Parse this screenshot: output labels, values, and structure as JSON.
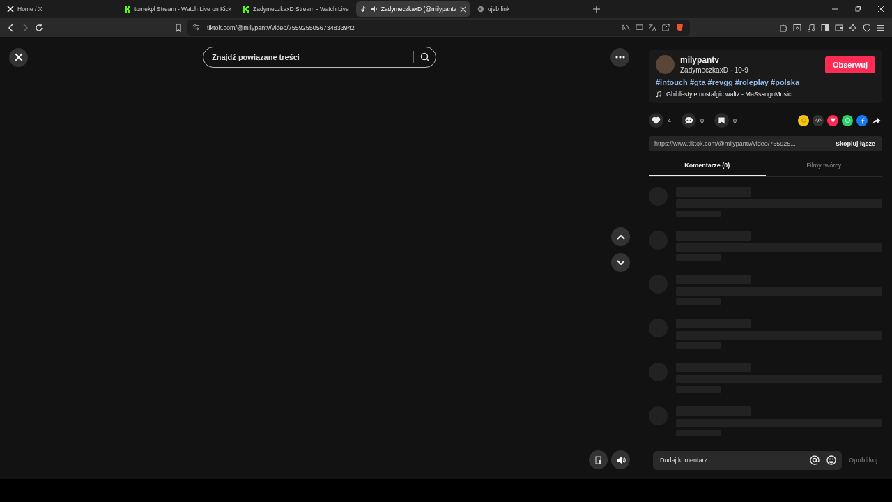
{
  "browser": {
    "tabs": [
      {
        "title": "Home / X",
        "kind": "x",
        "selected": false,
        "audio": false
      },
      {
        "title": "tomekpl Stream - Watch Live on Kick",
        "kind": "kick",
        "selected": false,
        "audio": false
      },
      {
        "title": "ZadymeczkaxD Stream - Watch Live",
        "kind": "kick",
        "selected": false,
        "audio": false
      },
      {
        "title": "ZadymeczkaxD (@milypantv",
        "kind": "tiktok",
        "selected": true,
        "audio": true
      },
      {
        "title": "ujeb link",
        "kind": "globe",
        "selected": false,
        "audio": false
      }
    ],
    "address": "tiktok.com/@milypantv/video/7559255056734833942"
  },
  "search": {
    "placeholder": "Znajdź powiązane treści"
  },
  "post": {
    "username": "milypantv",
    "subtitle": "ZadymeczkaxD · 10-9",
    "follow_label": "Obserwuj",
    "hashtags": "#intouch #gta #revgg #roleplay #polska",
    "music": "Ghibli-style nostalgic waltz - MaSssuguMusic",
    "stats": [
      {
        "kind": "like",
        "count": "4"
      },
      {
        "kind": "comment",
        "count": "0"
      },
      {
        "kind": "save",
        "count": "0"
      }
    ],
    "share_targets": [
      {
        "kind": "coin",
        "color": "#f5c518"
      },
      {
        "kind": "embed",
        "color": "#333333"
      },
      {
        "kind": "send",
        "color": "#fe2c55"
      },
      {
        "kind": "whatsapp",
        "color": "#25d366"
      },
      {
        "kind": "facebook",
        "color": "#1877f2"
      },
      {
        "kind": "forward",
        "color": "#121212"
      }
    ],
    "link": "https://www.tiktok.com/@milypantv/video/755925...",
    "copy_label": "Skopiuj łącze"
  },
  "panel_tabs": [
    {
      "label": "Komentarze (0)",
      "selected": true
    },
    {
      "label": "Filmy twórcy",
      "selected": false
    }
  ],
  "loading_comments": [
    {
      "kind": "skeleton"
    },
    {
      "kind": "skeleton"
    },
    {
      "kind": "skeleton"
    },
    {
      "kind": "skeleton"
    },
    {
      "kind": "skeleton"
    },
    {
      "kind": "skeleton"
    }
  ],
  "comment_box": {
    "placeholder": "Dodaj komentarz...",
    "post_label": "Opublikuj"
  }
}
